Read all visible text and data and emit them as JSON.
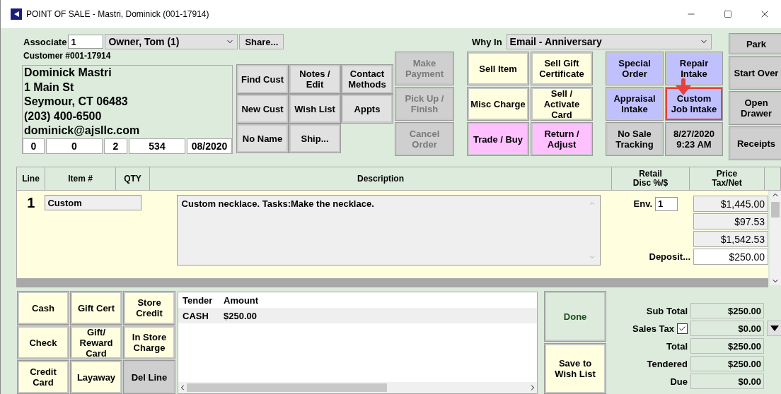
{
  "window": {
    "title": "POINT OF SALE - Mastri, Dominick (001-17914)"
  },
  "associate": {
    "label": "Associate",
    "value": "1",
    "name": "Owner, Tom (1)",
    "share": "Share..."
  },
  "customer": {
    "number": "Customer #001-17914",
    "lines": [
      "Dominick Mastri",
      "1 Main St",
      "Seymour, CT 06483",
      "(203) 400-6500",
      "dominick@ajsllc.com"
    ],
    "stats": [
      "0",
      "0",
      "2",
      "534",
      "08/2020"
    ]
  },
  "customer_buttons": [
    {
      "label": "Find Cust"
    },
    {
      "label": "Notes / Edit"
    },
    {
      "label": "Contact Methods"
    },
    {
      "label": "New Cust"
    },
    {
      "label": "Wish List"
    },
    {
      "label": "Appts"
    },
    {
      "label": "No Name"
    },
    {
      "label": "Ship..."
    }
  ],
  "why_in": {
    "label": "Why In",
    "value": "Email - Anniversary"
  },
  "action_buttons": [
    {
      "label": "Make Payment",
      "kind": "disabled",
      "highlighted": false
    },
    {
      "label": "Sell Item",
      "kind": "sale",
      "highlighted": false
    },
    {
      "label": "Sell Gift Certificate",
      "kind": "sale",
      "highlighted": false
    },
    {
      "label": "Special Order",
      "kind": "order",
      "highlighted": false
    },
    {
      "label": "Repair Intake",
      "kind": "order",
      "highlighted": false
    },
    {
      "label": "Pick Up / Finish",
      "kind": "disabled",
      "highlighted": false
    },
    {
      "label": "Misc Charge",
      "kind": "sale",
      "highlighted": false
    },
    {
      "label": "Sell / Activate Card",
      "kind": "sale",
      "highlighted": false
    },
    {
      "label": "Appraisal Intake",
      "kind": "order",
      "highlighted": false
    },
    {
      "label": "Custom Job Intake",
      "kind": "order",
      "highlighted": true
    },
    {
      "label": "Cancel Order",
      "kind": "disabled",
      "highlighted": false
    },
    {
      "label": "Trade / Buy",
      "kind": "trade",
      "highlighted": false
    },
    {
      "label": "Return / Adjust",
      "kind": "trade",
      "highlighted": false
    },
    {
      "label": "No Sale Tracking",
      "kind": "plain",
      "highlighted": false
    },
    {
      "label": "8/27/2020 9:23 AM",
      "kind": "plain",
      "highlighted": false
    }
  ],
  "side_buttons": [
    {
      "label": "Park"
    },
    {
      "label": "Start Over"
    },
    {
      "label": "Open Drawer"
    },
    {
      "label": "Receipts"
    }
  ],
  "table": {
    "columns": [
      "Line",
      "Item #",
      "QTY",
      "Description",
      "Retail Disc %/$",
      "Price Tax/Net"
    ],
    "rows": [
      {
        "line": "1",
        "item": "Custom",
        "description": "Custom necklace. Tasks:Make the necklace.",
        "env_label": "Env.",
        "env": "1",
        "prices": [
          "$1,445.00",
          "$97.53",
          "$1,542.53"
        ],
        "deposit_label": "Deposit...",
        "deposit": "$250.00"
      }
    ]
  },
  "tender_buttons": [
    {
      "label": "Cash",
      "kind": "tender"
    },
    {
      "label": "Gift Cert",
      "kind": "tender"
    },
    {
      "label": "Store Credit",
      "kind": "tender"
    },
    {
      "label": "Check",
      "kind": "tender"
    },
    {
      "label": "Gift/ Reward Card",
      "kind": "tender"
    },
    {
      "label": "In Store Charge",
      "kind": "tender"
    },
    {
      "label": "Credit Card",
      "kind": "tender"
    },
    {
      "label": "Layaway",
      "kind": "tender"
    },
    {
      "label": "Del Line",
      "kind": "plain"
    }
  ],
  "tenders": {
    "columns": [
      "Tender",
      "Amount"
    ],
    "rows": [
      [
        "CASH",
        "$250.00"
      ]
    ]
  },
  "finish_buttons": [
    {
      "label": "Done",
      "kind": "done"
    },
    {
      "label": "Save to Wish List",
      "kind": "save"
    }
  ],
  "totals": [
    {
      "label": "Sub Total",
      "value": "$250.00"
    },
    {
      "label": "Sales Tax",
      "value": "$0.00",
      "checked": true
    },
    {
      "label": "Total",
      "value": "$250.00"
    },
    {
      "label": "Tendered",
      "value": "$250.00"
    },
    {
      "label": "Due",
      "value": "$0.00"
    }
  ]
}
